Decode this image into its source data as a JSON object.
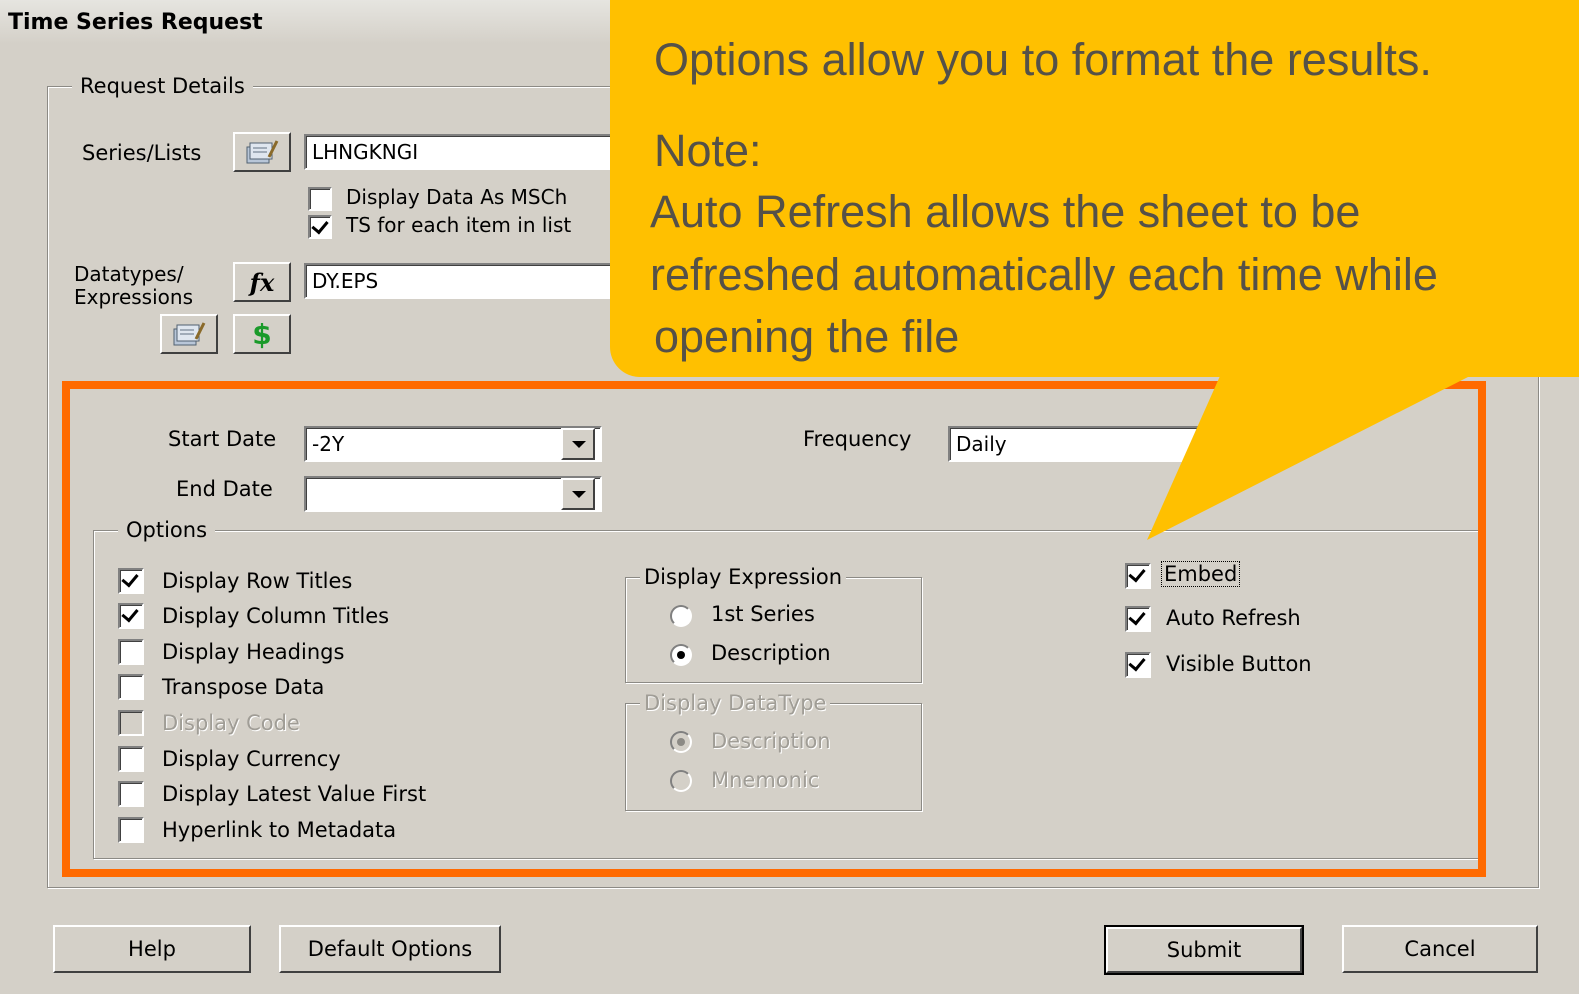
{
  "window": {
    "title": "Time Series Request"
  },
  "request_details": {
    "legend": "Request Details",
    "series_label": "Series/Lists",
    "series_value": "LHNGKNGI",
    "display_msch_label": "Display Data As MSCh",
    "ts_each_item_label": "TS for each item in list",
    "datatypes_label_line1": "Datatypes/",
    "datatypes_label_line2": "Expressions",
    "datatypes_value": "DY.EPS",
    "dollar_icon_text": "$",
    "fx_icon_text": "fx",
    "start_date_label": "Start Date",
    "start_date_value": "-2Y",
    "end_date_label": "End Date",
    "end_date_value": "",
    "frequency_label": "Frequency",
    "frequency_value": "Daily"
  },
  "options": {
    "legend": "Options",
    "checkboxes": [
      {
        "label": "Display Row Titles",
        "checked": true
      },
      {
        "label": "Display Column Titles",
        "checked": true
      },
      {
        "label": "Display Headings",
        "checked": false
      },
      {
        "label": "Transpose Data",
        "checked": false
      },
      {
        "label": "Display Code",
        "checked": false,
        "disabled": true
      },
      {
        "label": "Display Currency",
        "checked": false
      },
      {
        "label": "Display Latest Value First",
        "checked": false
      },
      {
        "label": "Hyperlink to Metadata",
        "checked": false
      }
    ],
    "display_expression": {
      "legend": "Display Expression",
      "options": [
        "1st Series",
        "Description"
      ],
      "selected": "Description"
    },
    "display_datatype": {
      "legend": "Display DataType",
      "options": [
        "Description",
        "Mnemonic"
      ],
      "selected": "Description",
      "disabled": true
    },
    "embed_label": "Embed",
    "auto_refresh_label": "Auto Refresh",
    "visible_button_label": "Visible Button"
  },
  "buttons": {
    "help": "Help",
    "default_options": "Default Options",
    "submit": "Submit",
    "cancel": "Cancel"
  },
  "callout": {
    "line1": "Options allow you to format the results.",
    "line2": "Note:",
    "line3": "Auto Refresh allows the sheet to be",
    "line4": "refreshed automatically each time while",
    "line5": "opening the file"
  },
  "colors": {
    "callout_bg": "#ffc000",
    "highlight_border": "#ff6a00",
    "dialog_bg": "#d4d0c8"
  }
}
